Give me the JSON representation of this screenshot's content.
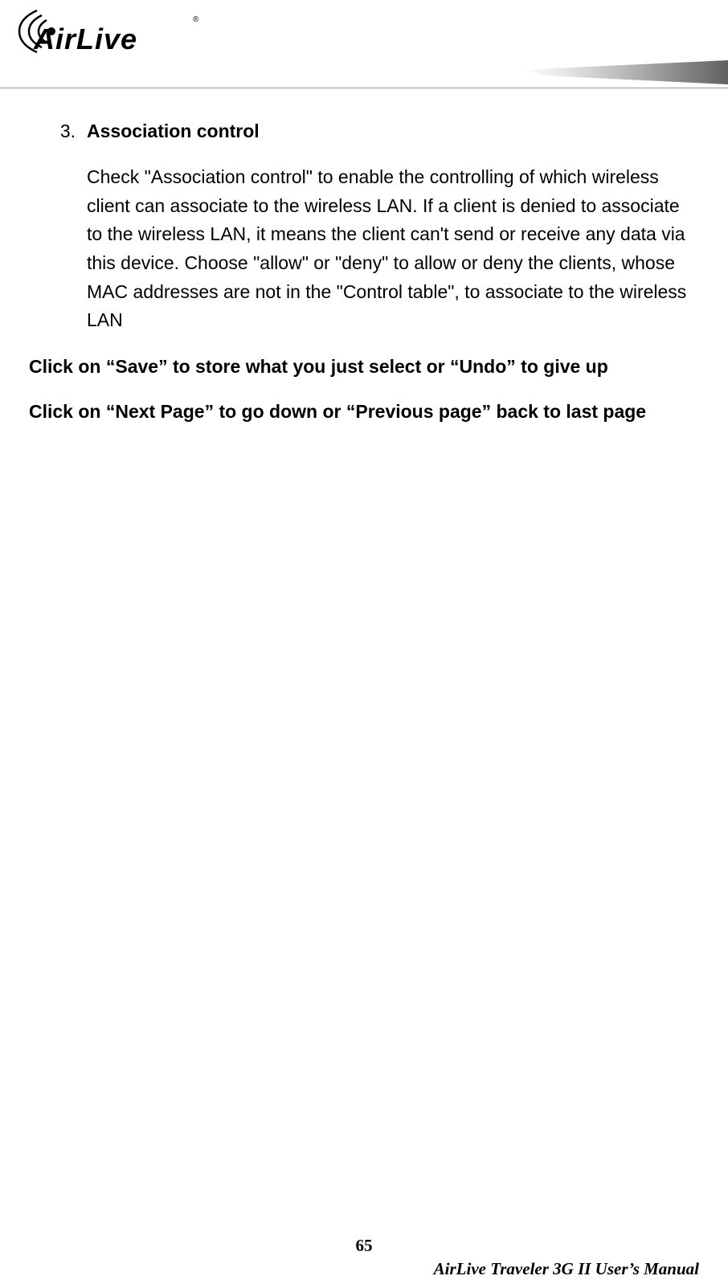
{
  "brand": "AirLive",
  "section": {
    "number": "3.",
    "title": "Association control",
    "body": "Check \"Association control\" to enable the controlling of which wireless client can associate to the wireless LAN. If a client is denied to associate to the wireless LAN, it means the client can't send or receive any data via this device. Choose \"allow\" or \"deny\" to allow or deny the clients, whose MAC addresses are not in the \"Control table\", to associate to the wireless LAN"
  },
  "bold_line_1": "Click on “Save” to store what you just select or “Undo” to give up",
  "bold_line_2": "Click on “Next Page” to go down or “Previous page” back to last page",
  "page_number": "65",
  "footer_title": "AirLive  Traveler  3G  II  User’s  Manual"
}
